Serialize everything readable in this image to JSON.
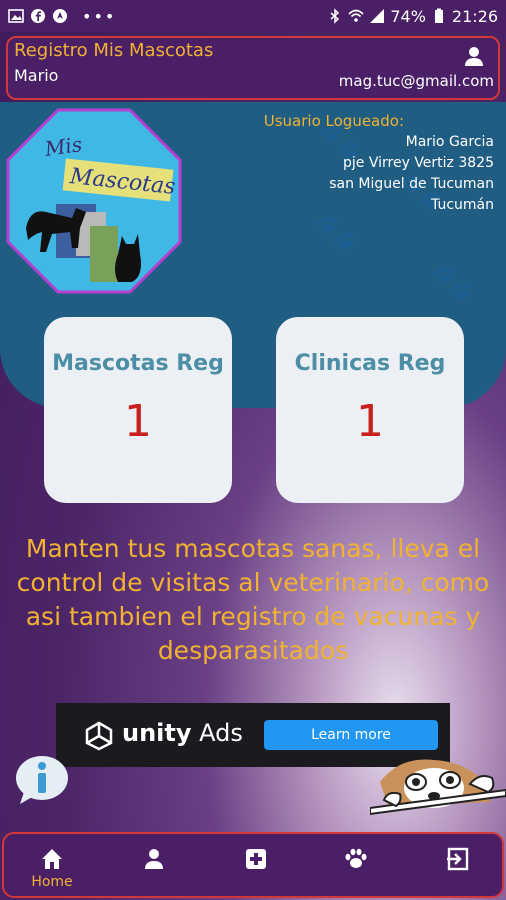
{
  "status_bar": {
    "battery": "74%",
    "time": "21:26"
  },
  "header": {
    "title": "Registro Mis Mascotas",
    "user_name": "Mario",
    "email": "mag.tuc@gmail.com"
  },
  "logo": {
    "line1": "Mis",
    "line2": "Mascotas"
  },
  "user_info": {
    "title": "Usuario Logueado:",
    "full_name": "Mario Garcia",
    "address": "pje Virrey Vertiz 3825",
    "city": "san Miguel de Tucuman",
    "province": "Tucumán"
  },
  "stats": [
    {
      "label": "Mascotas Reg",
      "value": "1"
    },
    {
      "label": "Clinicas Reg",
      "value": "1"
    }
  ],
  "promo_text": "Manten tus mascotas sanas, lleva el control de visitas al veterinario, como asi tambien el registro de vacunas y desparasitados",
  "ad": {
    "brand_bold": "unity",
    "brand_light": "Ads",
    "cta": "Learn more"
  },
  "bottom_nav": {
    "items": [
      {
        "label": "Home",
        "icon": "home-icon"
      },
      {
        "label": "",
        "icon": "person-icon"
      },
      {
        "label": "",
        "icon": "medical-plus-icon"
      },
      {
        "label": "",
        "icon": "paw-icon"
      },
      {
        "label": "",
        "icon": "logout-icon"
      }
    ]
  },
  "colors": {
    "accent_orange": "#f1b232",
    "header_purple": "#4a1f66",
    "teal": "#1f5d82",
    "border_red": "#d2373a",
    "stat_number": "#c9201f"
  }
}
